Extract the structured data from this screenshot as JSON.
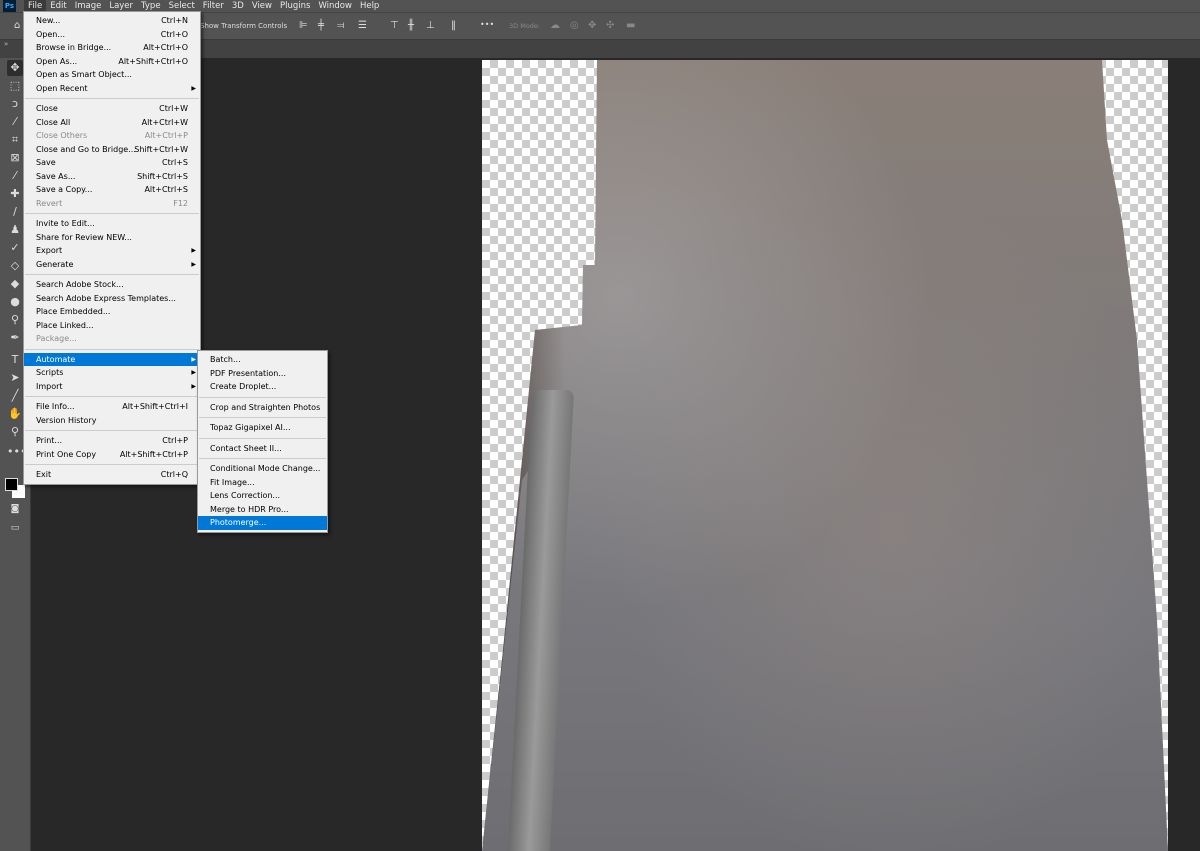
{
  "app": {
    "logo": "Ps"
  },
  "menubar": [
    "File",
    "Edit",
    "Image",
    "Layer",
    "Type",
    "Select",
    "Filter",
    "3D",
    "View",
    "Plugins",
    "Window",
    "Help"
  ],
  "options": {
    "transform_label": "Show Transform Controls",
    "more": "•••",
    "mode_label": "3D Mode:"
  },
  "file_menu": [
    {
      "label": "New...",
      "shortcut": "Ctrl+N"
    },
    {
      "label": "Open...",
      "shortcut": "Ctrl+O"
    },
    {
      "label": "Browse in Bridge...",
      "shortcut": "Alt+Ctrl+O"
    },
    {
      "label": "Open As...",
      "shortcut": "Alt+Shift+Ctrl+O"
    },
    {
      "label": "Open as Smart Object...",
      "shortcut": ""
    },
    {
      "label": "Open Recent",
      "shortcut": "",
      "submenu": true
    },
    {
      "sep": true
    },
    {
      "label": "Close",
      "shortcut": "Ctrl+W"
    },
    {
      "label": "Close All",
      "shortcut": "Alt+Ctrl+W"
    },
    {
      "label": "Close Others",
      "shortcut": "Alt+Ctrl+P",
      "disabled": true
    },
    {
      "label": "Close and Go to Bridge...",
      "shortcut": "Shift+Ctrl+W"
    },
    {
      "label": "Save",
      "shortcut": "Ctrl+S"
    },
    {
      "label": "Save As...",
      "shortcut": "Shift+Ctrl+S"
    },
    {
      "label": "Save a Copy...",
      "shortcut": "Alt+Ctrl+S"
    },
    {
      "label": "Revert",
      "shortcut": "F12",
      "disabled": true
    },
    {
      "sep": true
    },
    {
      "label": "Invite to Edit...",
      "shortcut": ""
    },
    {
      "label": "Share for Review NEW...",
      "shortcut": ""
    },
    {
      "label": "Export",
      "shortcut": "",
      "submenu": true
    },
    {
      "label": "Generate",
      "shortcut": "",
      "submenu": true
    },
    {
      "sep": true
    },
    {
      "label": "Search Adobe Stock...",
      "shortcut": ""
    },
    {
      "label": "Search Adobe Express Templates...",
      "shortcut": ""
    },
    {
      "label": "Place Embedded...",
      "shortcut": ""
    },
    {
      "label": "Place Linked...",
      "shortcut": ""
    },
    {
      "label": "Package...",
      "shortcut": "",
      "disabled": true
    },
    {
      "sep": true
    },
    {
      "label": "Automate",
      "shortcut": "",
      "submenu": true,
      "highlighted": true
    },
    {
      "label": "Scripts",
      "shortcut": "",
      "submenu": true
    },
    {
      "label": "Import",
      "shortcut": "",
      "submenu": true
    },
    {
      "sep": true
    },
    {
      "label": "File Info...",
      "shortcut": "Alt+Shift+Ctrl+I"
    },
    {
      "label": "Version History",
      "shortcut": ""
    },
    {
      "sep": true
    },
    {
      "label": "Print...",
      "shortcut": "Ctrl+P"
    },
    {
      "label": "Print One Copy",
      "shortcut": "Alt+Shift+Ctrl+P"
    },
    {
      "sep": true
    },
    {
      "label": "Exit",
      "shortcut": "Ctrl+Q"
    }
  ],
  "automate_menu": [
    {
      "label": "Batch..."
    },
    {
      "label": "PDF Presentation..."
    },
    {
      "label": "Create Droplet..."
    },
    {
      "sep": true
    },
    {
      "label": "Crop and Straighten Photos"
    },
    {
      "sep": true
    },
    {
      "label": "Topaz Gigapixel AI..."
    },
    {
      "sep": true
    },
    {
      "label": "Contact Sheet II..."
    },
    {
      "sep": true
    },
    {
      "label": "Conditional Mode Change..."
    },
    {
      "label": "Fit Image..."
    },
    {
      "label": "Lens Correction..."
    },
    {
      "label": "Merge to HDR Pro..."
    },
    {
      "label": "Photomerge...",
      "highlighted": true
    }
  ],
  "colors": {
    "highlight": "#0078d7",
    "foreground": "#000000",
    "background": "#ffffff"
  }
}
